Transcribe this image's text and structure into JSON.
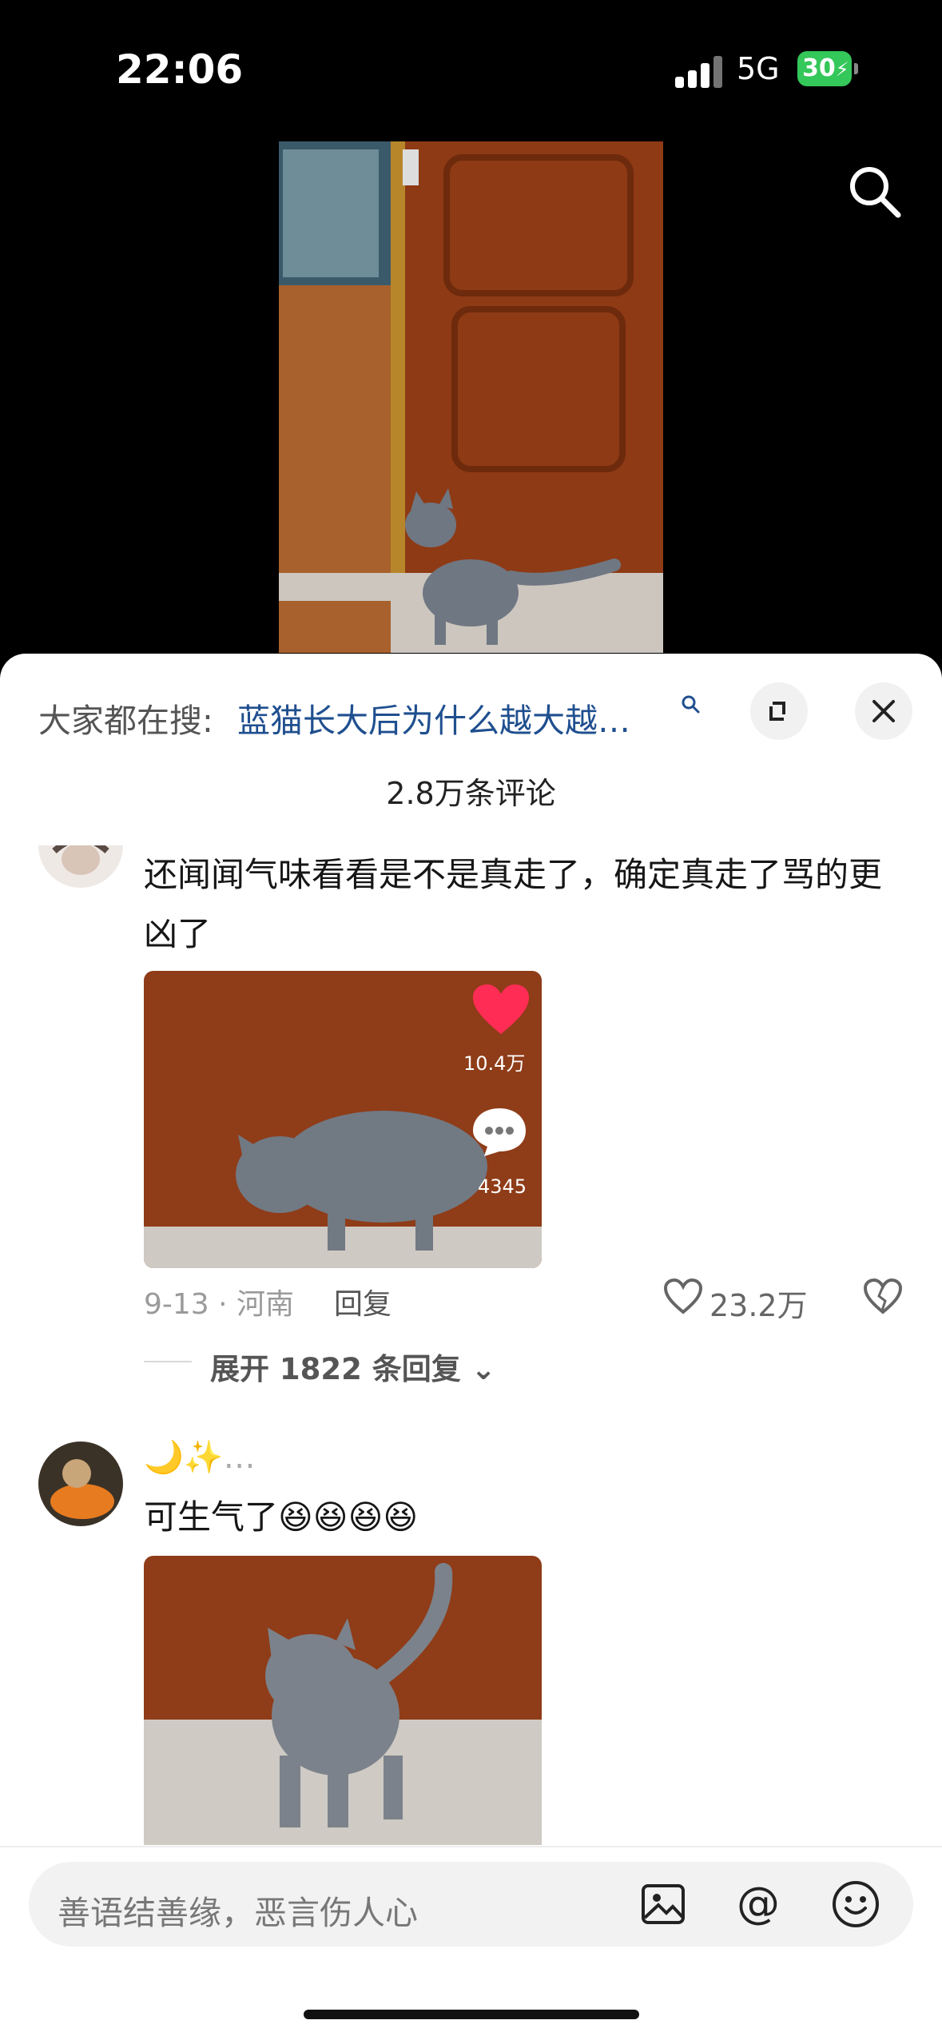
{
  "status_bar": {
    "time": "22:06",
    "network": "5G",
    "battery": "30"
  },
  "video": {
    "description_icon": "search-icon"
  },
  "sheet": {
    "hot_search_prefix": "大家都在搜:",
    "hot_search_query": "蓝猫长大后为什么越大越…",
    "comment_count": "2.8万条评论"
  },
  "comments": [
    {
      "text": "还闻闻气味看看是不是真走了，确定真走了骂的更凶了",
      "image_overlay": {
        "likes": "10.4万",
        "comments": "4345"
      },
      "date_location": "9-13 · 河南",
      "reply_label": "回复",
      "like_count": "23.2万",
      "expand_replies": "展开 1822 条回复"
    },
    {
      "nickname": "🌙✨…",
      "text": "可生气了😆😆😆😆"
    }
  ],
  "bottom": {
    "input_placeholder": "善语结善缘，恶言伤人心"
  },
  "colors": {
    "accent_link": "#1f4f8f",
    "like_red": "#ff2d55",
    "battery_green": "#34c759"
  }
}
